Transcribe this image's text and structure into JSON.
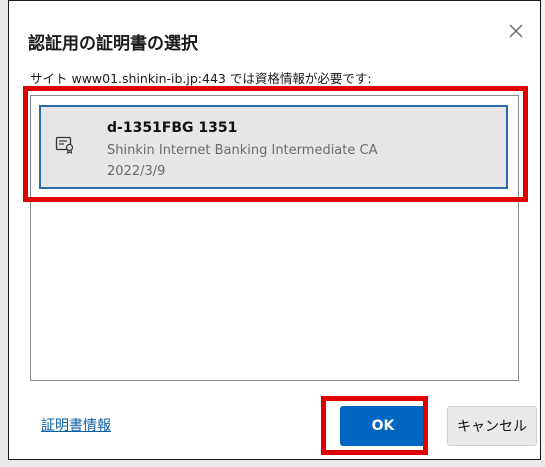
{
  "dialog": {
    "title": "認証用の証明書の選択",
    "subtitle": "サイト www01.shinkin-ib.jp:443 では資格情報が必要です:",
    "close_icon": "close-icon"
  },
  "certificates": [
    {
      "name": "d-1351FBG  1351",
      "issuer": "Shinkin Internet Banking Intermediate CA",
      "date": "2022/3/9",
      "icon": "certificate-icon"
    }
  ],
  "footer": {
    "cert_info_link": "証明書情報",
    "ok_label": "OK",
    "cancel_label": "キャンセル"
  },
  "colors": {
    "accent": "#0067c0",
    "highlight": "#e00000",
    "selected_border": "#2b6cb0"
  }
}
